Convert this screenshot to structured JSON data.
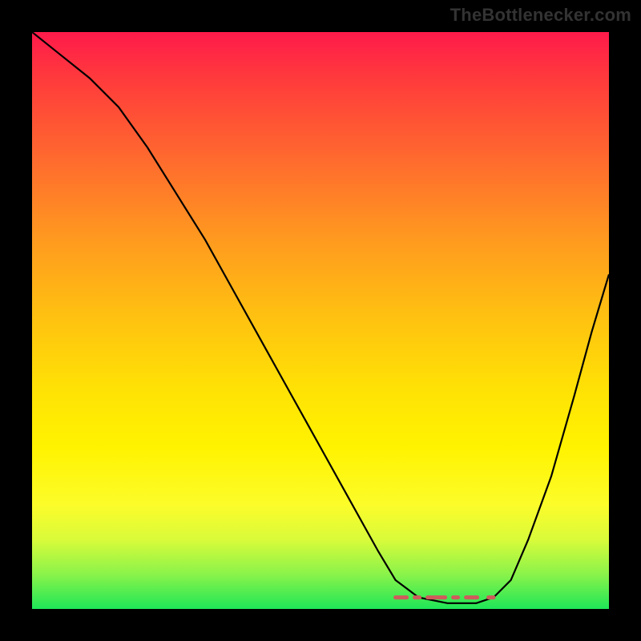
{
  "watermark": "TheBottlenecker.com",
  "chart_data": {
    "type": "line",
    "title": "",
    "xlabel": "",
    "ylabel": "",
    "xlim": [
      0,
      100
    ],
    "ylim": [
      0,
      100
    ],
    "grid": false,
    "legend": false,
    "background_gradient": {
      "top": "#ff1a4b",
      "bottom": "#1ee657",
      "semantic": "red (bad) at top through yellow to green (good) at bottom"
    },
    "series": [
      {
        "name": "main-curve",
        "color": "#000000",
        "x": [
          0,
          5,
          10,
          15,
          20,
          25,
          30,
          35,
          40,
          45,
          50,
          55,
          60,
          63,
          67,
          72,
          77,
          80,
          83,
          86,
          90,
          94,
          97,
          100
        ],
        "y": [
          100,
          96,
          92,
          87,
          80,
          72,
          64,
          55,
          46,
          37,
          28,
          19,
          10,
          5,
          2,
          1,
          1,
          2,
          5,
          12,
          23,
          37,
          48,
          58
        ]
      },
      {
        "name": "optimal-band-marker",
        "color": "#d46a6a",
        "style": "dashed",
        "x": [
          63,
          80
        ],
        "y": [
          2,
          2
        ],
        "note": "short red dashed segment highlighting the flat minimum region"
      }
    ]
  }
}
